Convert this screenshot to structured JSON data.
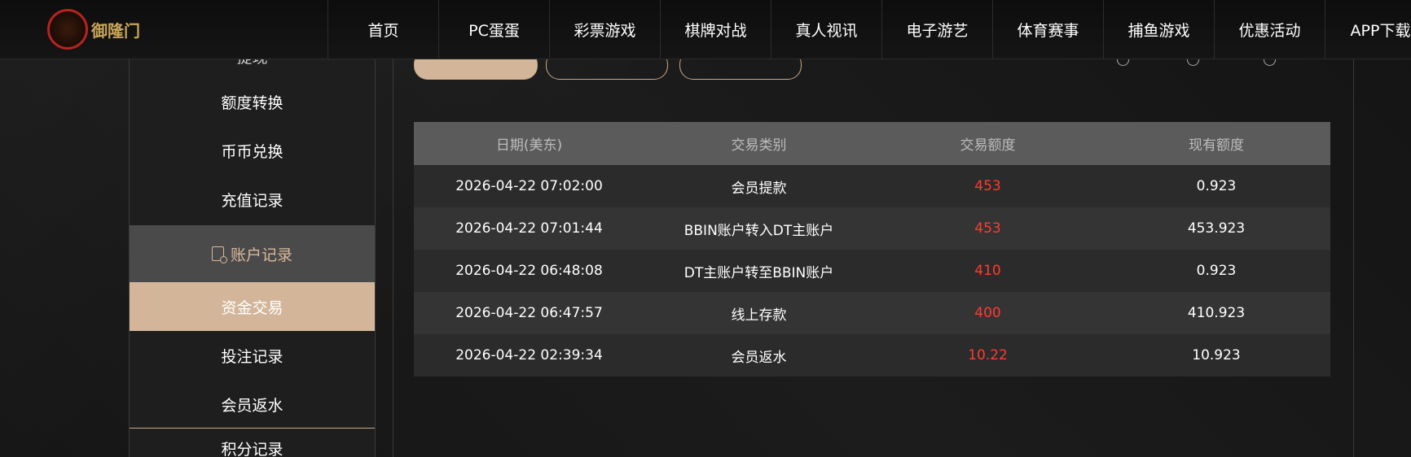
{
  "brand": {
    "logo_text": "御隆门",
    "logo_mark": "YL"
  },
  "nav": {
    "items": [
      "首页",
      "PC蛋蛋",
      "彩票游戏",
      "棋牌对战",
      "真人视讯",
      "电子游艺",
      "体育赛事",
      "捕鱼游戏",
      "优惠活动",
      "APP下载"
    ]
  },
  "sidebar": {
    "items_top": [
      "提现",
      "额度转换",
      "币币兑换",
      "充值记录"
    ],
    "group_label": "账户记录",
    "active_item": "资金交易",
    "items_bottom": [
      "投注记录",
      "会员返水",
      "积分记录"
    ]
  },
  "table": {
    "headers": [
      "日期(美东)",
      "交易类别",
      "交易额度",
      "现有额度"
    ],
    "rows": [
      [
        "2026-04-22 07:02:00",
        "会员提款",
        "453",
        "0.923"
      ],
      [
        "2026-04-22 07:01:44",
        "BBIN账户转入DT主账户",
        "453",
        "453.923"
      ],
      [
        "2026-04-22 06:48:08",
        "DT主账户转至BBIN账户",
        "410",
        "0.923"
      ],
      [
        "2026-04-22 06:47:57",
        "线上存款",
        "400",
        "410.923"
      ],
      [
        "2026-04-22 02:39:34",
        "会员返水",
        "10.22",
        "10.923"
      ]
    ]
  },
  "colors": {
    "accent": "#d3b69a",
    "amount": "#ff3b30",
    "header_bg": "#5b5b5b"
  }
}
